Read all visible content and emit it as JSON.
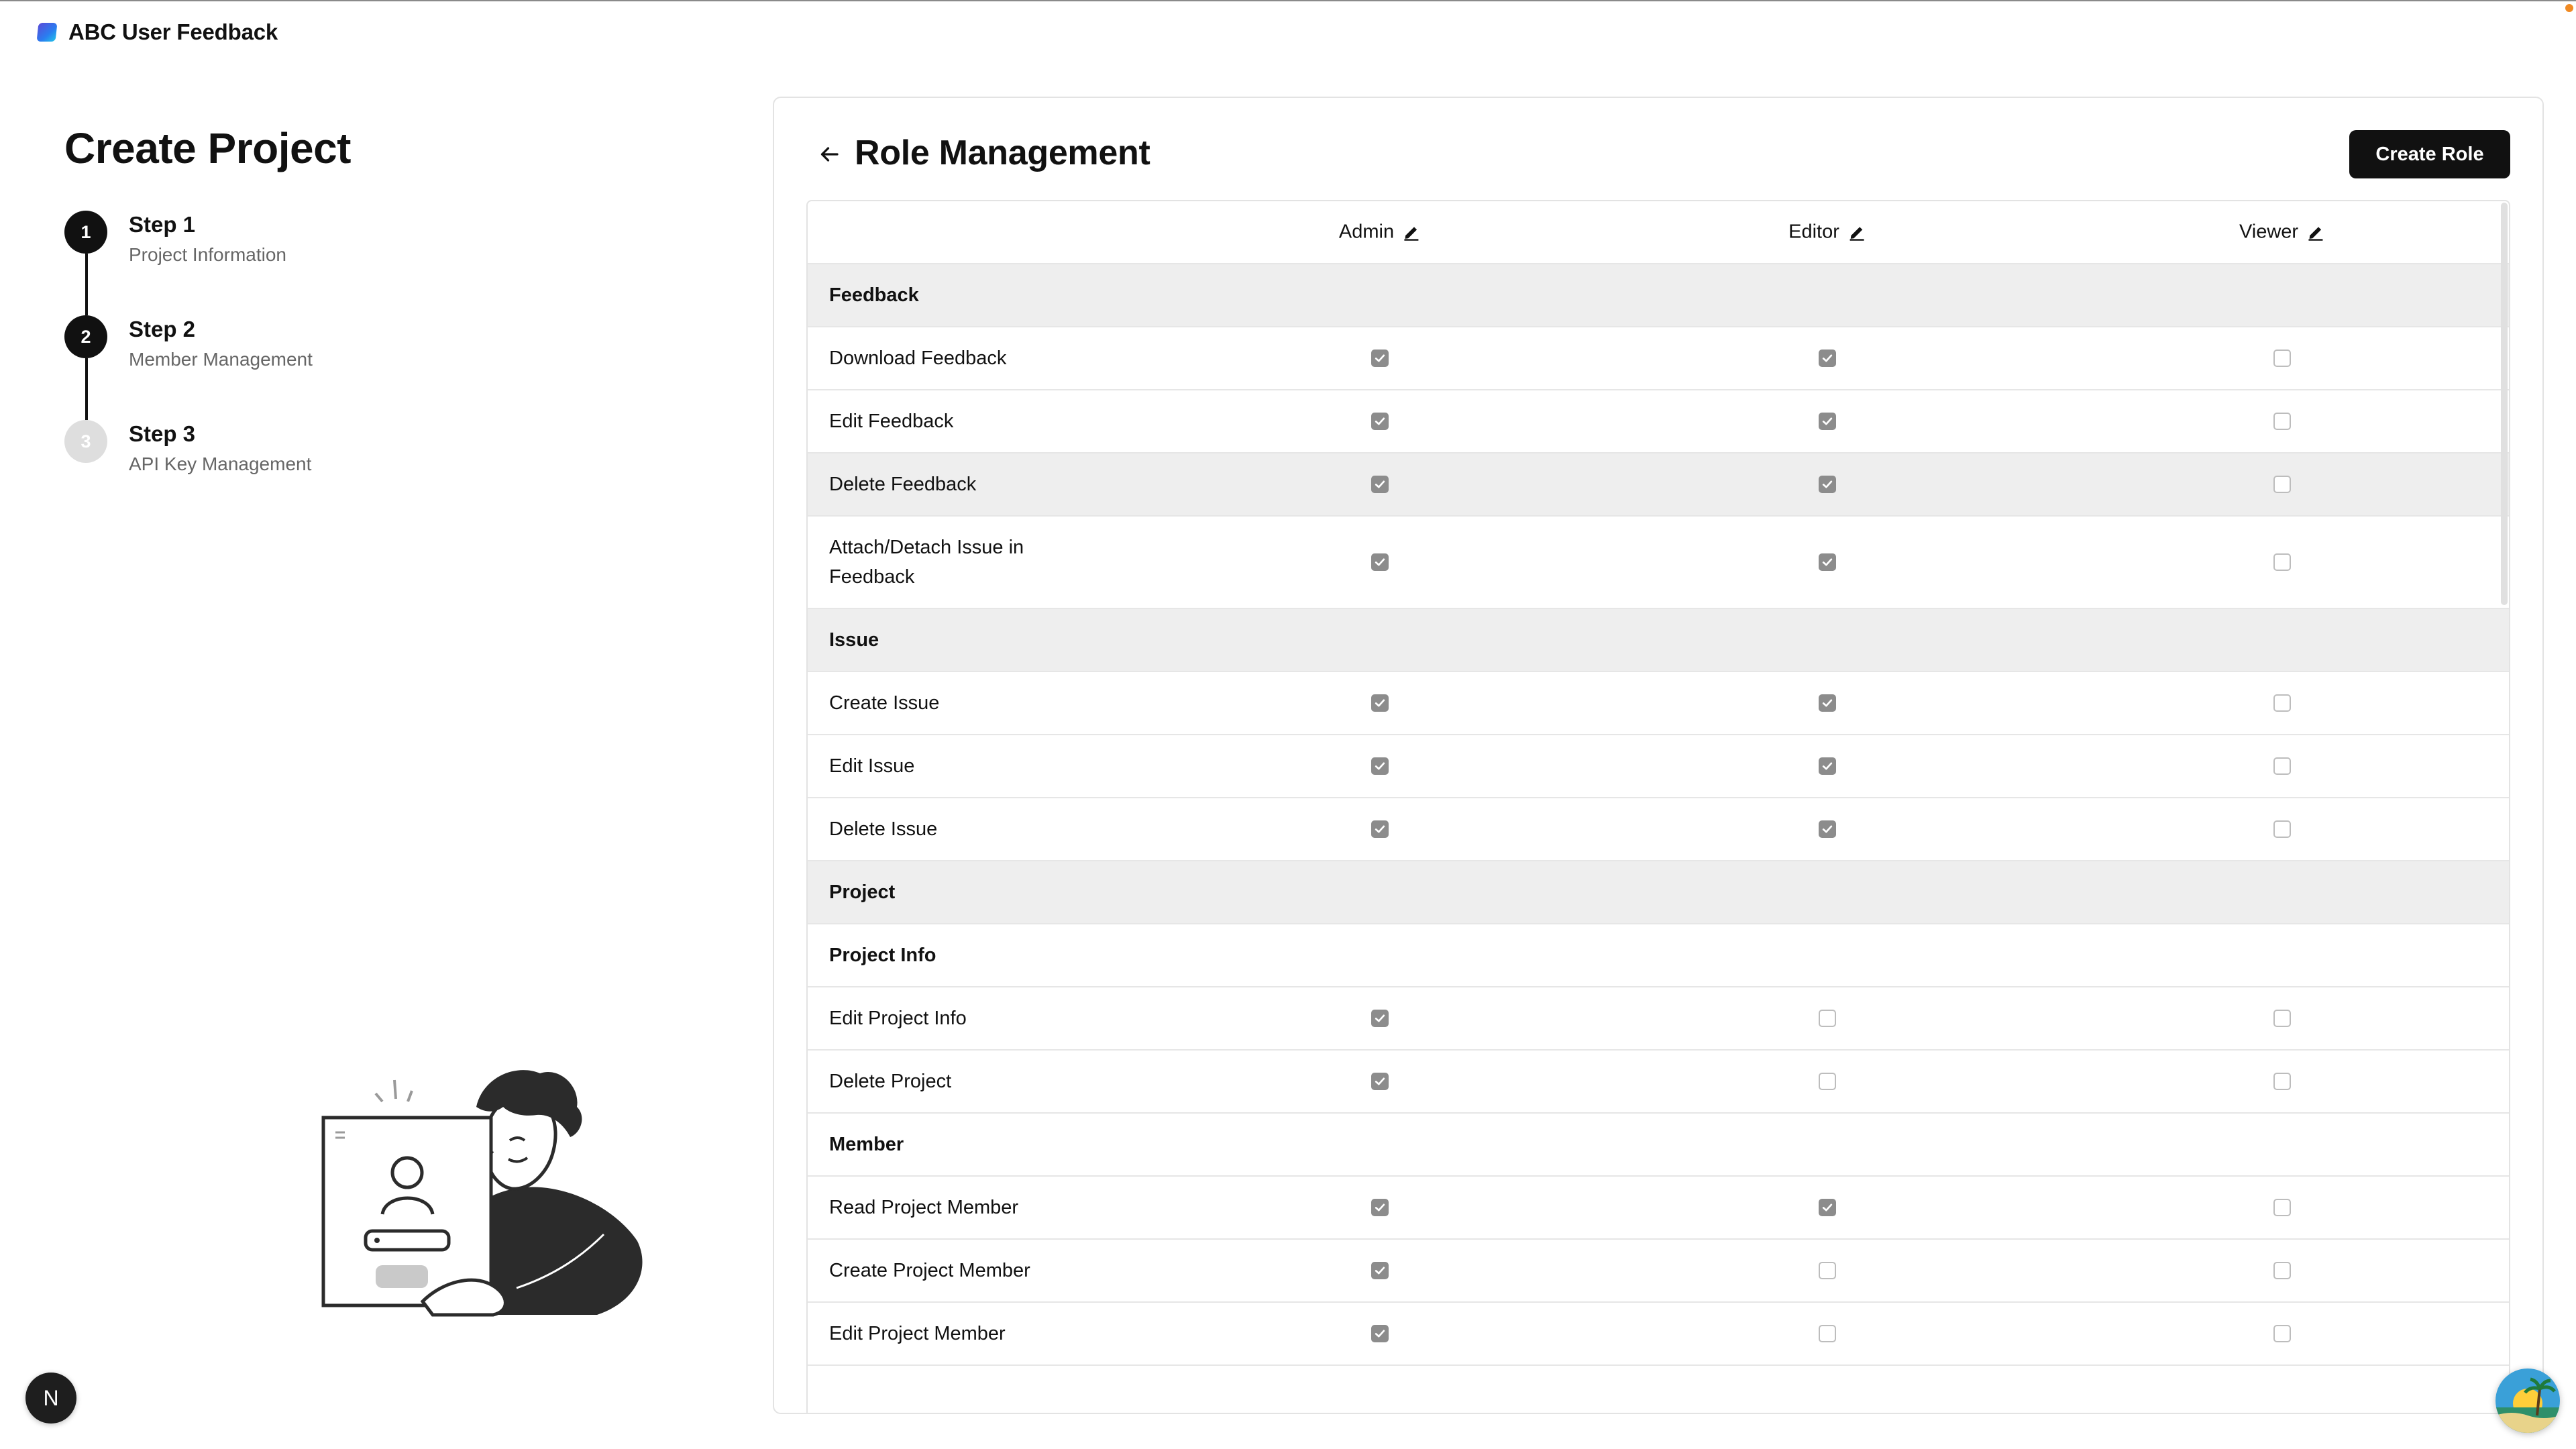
{
  "app": {
    "name": "ABC User Feedback"
  },
  "page": {
    "title": "Create Project"
  },
  "steps": [
    {
      "number": "1",
      "title": "Step 1",
      "subtitle": "Project Information",
      "state": "done"
    },
    {
      "number": "2",
      "title": "Step 2",
      "subtitle": "Member Management",
      "state": "active"
    },
    {
      "number": "3",
      "title": "Step 3",
      "subtitle": "API Key Management",
      "state": "pending"
    }
  ],
  "panel": {
    "title": "Role Management",
    "create_role_label": "Create Role",
    "roles": [
      "Admin",
      "Editor",
      "Viewer"
    ],
    "rows": [
      {
        "type": "category",
        "label": "Feedback"
      },
      {
        "type": "perm",
        "label": "Download Feedback",
        "values": [
          true,
          true,
          false
        ]
      },
      {
        "type": "perm",
        "label": "Edit Feedback",
        "values": [
          true,
          true,
          false
        ]
      },
      {
        "type": "perm",
        "label": "Delete Feedback",
        "values": [
          true,
          true,
          false
        ],
        "highlight": true
      },
      {
        "type": "perm",
        "label": "Attach/Detach Issue in Feedback",
        "values": [
          true,
          true,
          false
        ],
        "tall": true
      },
      {
        "type": "category",
        "label": "Issue"
      },
      {
        "type": "perm",
        "label": "Create Issue",
        "values": [
          true,
          true,
          false
        ]
      },
      {
        "type": "perm",
        "label": "Edit Issue",
        "values": [
          true,
          true,
          false
        ]
      },
      {
        "type": "perm",
        "label": "Delete Issue",
        "values": [
          true,
          true,
          false
        ]
      },
      {
        "type": "category",
        "label": "Project"
      },
      {
        "type": "subcategory",
        "label": "Project Info"
      },
      {
        "type": "perm",
        "label": "Edit Project Info",
        "values": [
          true,
          false,
          false
        ]
      },
      {
        "type": "perm",
        "label": "Delete Project",
        "values": [
          true,
          false,
          false
        ]
      },
      {
        "type": "subcategory",
        "label": "Member"
      },
      {
        "type": "perm",
        "label": "Read Project Member",
        "values": [
          true,
          true,
          false
        ]
      },
      {
        "type": "perm",
        "label": "Create Project Member",
        "values": [
          true,
          false,
          false
        ]
      },
      {
        "type": "perm",
        "label": "Edit Project Member",
        "values": [
          true,
          false,
          false
        ]
      }
    ]
  },
  "floating": {
    "n_badge": "N"
  },
  "colors": {
    "checked": "#8c8c8c",
    "unchecked_border": "#bdbdbd",
    "category_bg": "#eeeeee",
    "primary": "#111111"
  }
}
